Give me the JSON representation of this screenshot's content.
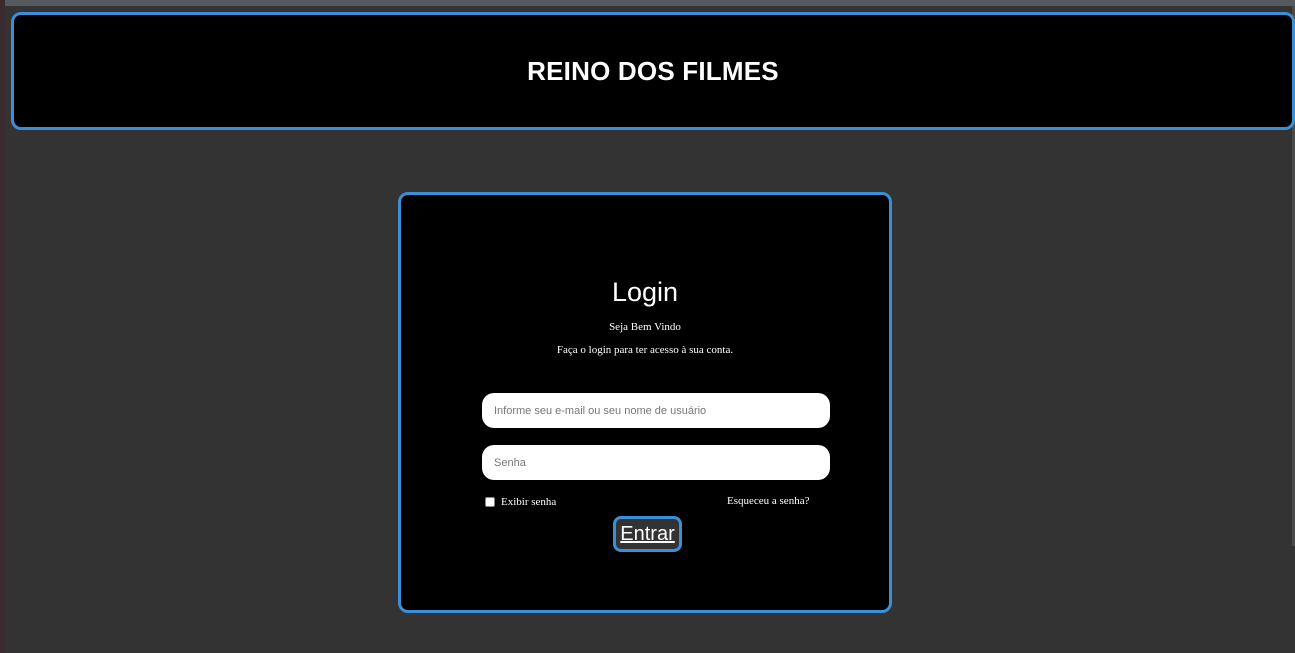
{
  "header": {
    "title": "REINO DOS FILMES"
  },
  "login": {
    "title": "Login",
    "welcome": "Seja Bem Vindo",
    "subtitle": "Faça o login para ter acesso à sua conta.",
    "email_placeholder": "Informe seu e-mail ou seu nome de usuário",
    "email_value": "",
    "password_placeholder": "Senha",
    "password_value": "",
    "show_password_label": "Exibir senha",
    "show_password_checked": false,
    "forgot_label": "Esqueceu a senha?",
    "submit_label": "Entrar"
  },
  "colors": {
    "accent": "#3a8fd6",
    "page_background": "#333333",
    "panel_background": "#000000"
  }
}
